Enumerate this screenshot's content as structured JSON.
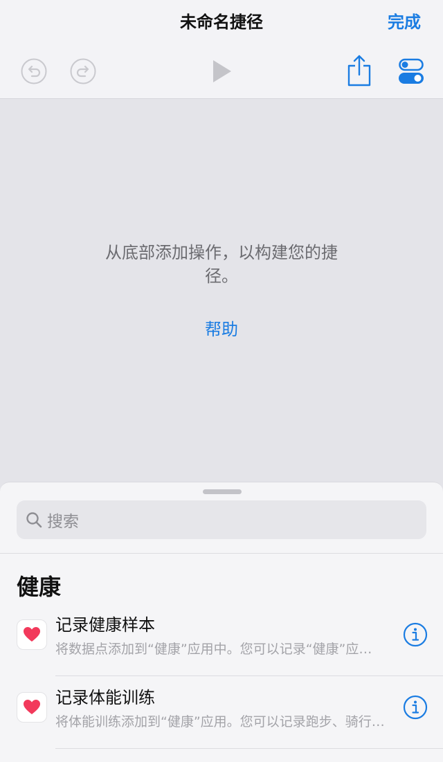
{
  "nav": {
    "title": "未命名捷径",
    "done_label": "完成"
  },
  "toolbar": {
    "undo_icon": "undo-icon",
    "redo_icon": "redo-icon",
    "play_icon": "play-icon",
    "share_icon": "share-icon",
    "settings_icon": "toggles-icon"
  },
  "canvas": {
    "empty_message": "从底部添加操作，以构建您的捷径。",
    "help_label": "帮助"
  },
  "sheet": {
    "search_placeholder": "搜索",
    "section_title": "健康",
    "actions": [
      {
        "title": "记录健康样本",
        "subtitle": "将数据点添加到“健康”应用中。您可以记录“健康”应用中的数据",
        "icon": "health-heart-icon"
      },
      {
        "title": "记录体能训练",
        "subtitle": "将体能训练添加到“健康”应用。您可以记录跑步、骑行等体能训练",
        "icon": "health-heart-icon"
      }
    ]
  },
  "colors": {
    "accent": "#1a7ce2",
    "heart": "#f2395b",
    "background": "#e4e4e9"
  }
}
